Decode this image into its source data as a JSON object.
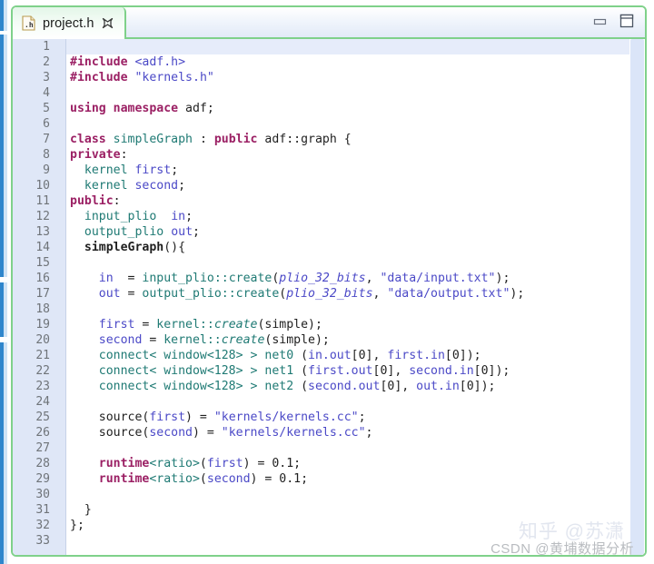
{
  "window": {
    "tab": {
      "label": "project.h",
      "icon": "h-file-icon",
      "close_icon": "close-icon"
    },
    "controls": [
      {
        "name": "minimize-button",
        "icon": "minimize-icon"
      },
      {
        "name": "maximize-button",
        "icon": "maximize-icon"
      }
    ]
  },
  "editor": {
    "first_line": 1,
    "last_line": 33,
    "current_line": 1,
    "fold_markers": [
      7,
      14
    ],
    "line_numbers": [
      "1",
      "2",
      "3",
      "4",
      "5",
      "6",
      "7",
      "8",
      "9",
      "10",
      "11",
      "12",
      "13",
      "14",
      "15",
      "16",
      "17",
      "18",
      "19",
      "20",
      "21",
      "22",
      "23",
      "24",
      "25",
      "26",
      "27",
      "28",
      "29",
      "30",
      "31",
      "32",
      "33"
    ],
    "lines": [
      "",
      "#include <adf.h>",
      "#include \"kernels.h\"",
      "",
      "using namespace adf;",
      "",
      "class simpleGraph : public adf::graph {",
      "private:",
      "  kernel first;",
      "  kernel second;",
      "public:",
      "  input_plio  in;",
      "  output_plio out;",
      "  simpleGraph(){",
      "",
      "    in  = input_plio::create(plio_32_bits, \"data/input.txt\");",
      "    out = output_plio::create(plio_32_bits, \"data/output.txt\");",
      "",
      "    first = kernel::create(simple);",
      "    second = kernel::create(simple);",
      "    connect< window<128> > net0 (in.out[0], first.in[0]);",
      "    connect< window<128> > net1 (first.out[0], second.in[0]);",
      "    connect< window<128> > net2 (second.out[0], out.in[0]);",
      "",
      "    source(first) = \"kernels/kernels.cc\";",
      "    source(second) = \"kernels/kernels.cc\";",
      "",
      "    runtime<ratio>(first) = 0.1;",
      "    runtime<ratio>(second) = 0.1;",
      "",
      "  }",
      "};",
      ""
    ],
    "language": "C++",
    "file_name": "project.h"
  },
  "watermarks": {
    "csdn": "CSDN @黄埔数据分析",
    "zhihu": "知乎 @苏潇"
  },
  "colors": {
    "accent_border": "#7fd18a",
    "keyword": "#9b2064",
    "string": "#4b49c7",
    "type": "#1f7a74",
    "field": "#4b49c7",
    "gutter_bg": "#dfe7f7",
    "current_line_bg": "#e6ecfa",
    "scrollbar": "#dbe5f8"
  }
}
